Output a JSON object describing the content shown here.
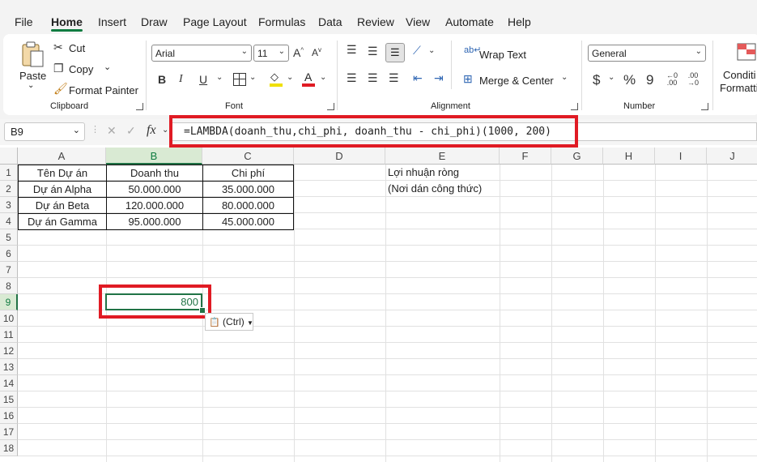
{
  "menu": {
    "items": [
      "File",
      "Home",
      "Insert",
      "Draw",
      "Page Layout",
      "Formulas",
      "Data",
      "Review",
      "View",
      "Automate",
      "Help"
    ]
  },
  "ribbon": {
    "clipboard": {
      "paste": "Paste",
      "cut": "Cut",
      "copy": "Copy",
      "format_painter": "Format Painter",
      "group": "Clipboard"
    },
    "font": {
      "name": "Arial",
      "size": "11",
      "group": "Font"
    },
    "alignment": {
      "wrap_text": "Wrap Text",
      "merge_center": "Merge & Center",
      "group": "Alignment"
    },
    "number": {
      "format": "General",
      "currency": "$",
      "percent": "%",
      "comma": "9",
      "group": "Number"
    },
    "styles": {
      "conditional_line1": "Conditi",
      "conditional_line2": "Formatti"
    }
  },
  "formula_bar": {
    "name_box": "B9",
    "fx": "fx",
    "formula": "=LAMBDA(doanh_thu,chi_phi, doanh_thu - chi_phi)(1000, 200)"
  },
  "sheet": {
    "columns": [
      "A",
      "B",
      "C",
      "D",
      "E",
      "F",
      "G",
      "H",
      "I",
      "J"
    ],
    "rows": [
      "1",
      "2",
      "3",
      "4",
      "5",
      "6",
      "7",
      "8",
      "9",
      "10",
      "11",
      "12",
      "13",
      "14",
      "15",
      "16",
      "17",
      "18"
    ],
    "table": {
      "headers": [
        "Tên Dự án",
        "Doanh thu",
        "Chi phí"
      ],
      "rows": [
        [
          "Dự án Alpha",
          "50.000.000",
          "35.000.000"
        ],
        [
          "Dự án Beta",
          "120.000.000",
          "80.000.000"
        ],
        [
          "Dự án Gamma",
          "95.000.000",
          "45.000.000"
        ]
      ]
    },
    "e1": "Lợi nhuận ròng",
    "e2": "(Nơi dán công thức)",
    "b9": "800",
    "paste_options": "(Ctrl)"
  },
  "colors": {
    "accent": "#107c41",
    "highlight": "#e01b24",
    "selection": "#217346"
  }
}
